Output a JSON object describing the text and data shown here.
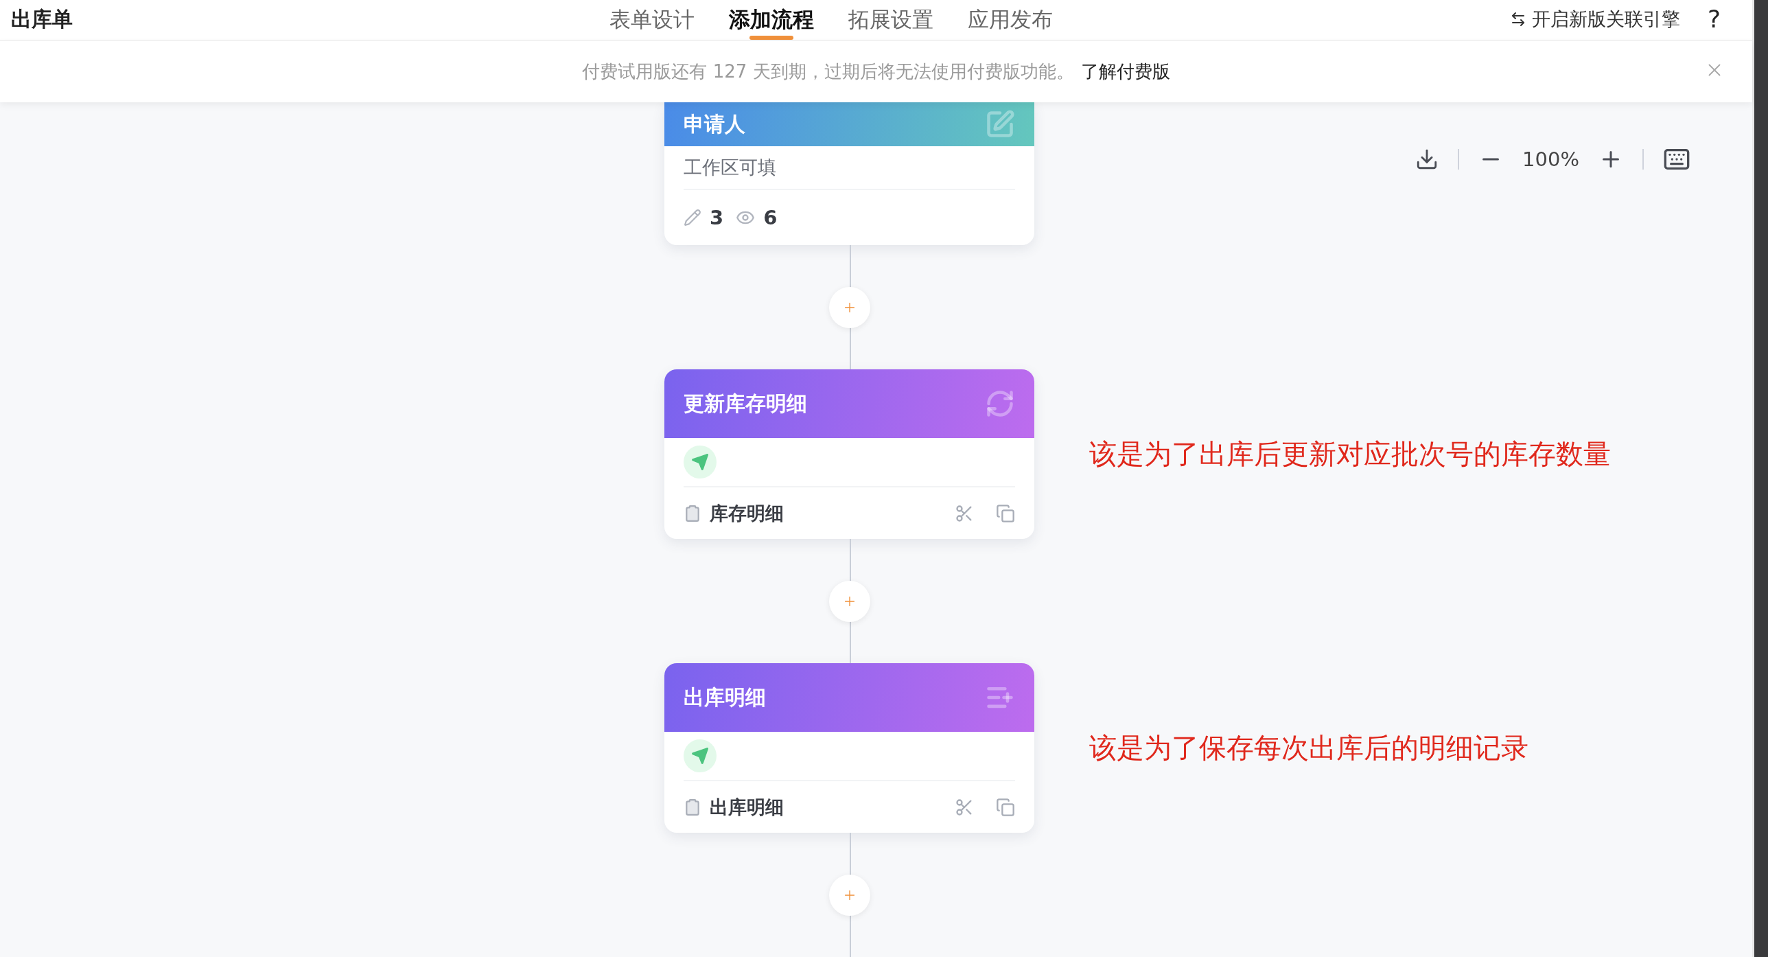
{
  "app": {
    "title": "出库单"
  },
  "tabs": [
    {
      "label": "表单设计",
      "selected": false
    },
    {
      "label": "添加流程",
      "selected": true
    },
    {
      "label": "拓展设置",
      "selected": false
    },
    {
      "label": "应用发布",
      "selected": false
    }
  ],
  "engine_link": {
    "label": "开启新版关联引擎"
  },
  "help": "?",
  "notice": {
    "text": "付费试用版还有 127 天到期，过期后将无法使用付费版功能。",
    "link": "了解付费版"
  },
  "zoom": {
    "value": "100%"
  },
  "nodes": [
    {
      "kind": "applicant",
      "title": "申请人",
      "permission": "工作区可填",
      "edit_count": "3",
      "view_count": "6"
    },
    {
      "kind": "update",
      "title": "更新库存明细",
      "form": "库存明细",
      "note": "该是为了出库后更新对应批次号的库存数量"
    },
    {
      "kind": "create",
      "title": "出库明细",
      "form": "出库明细",
      "note": "该是为了保存每次出库后的明细记录"
    }
  ]
}
